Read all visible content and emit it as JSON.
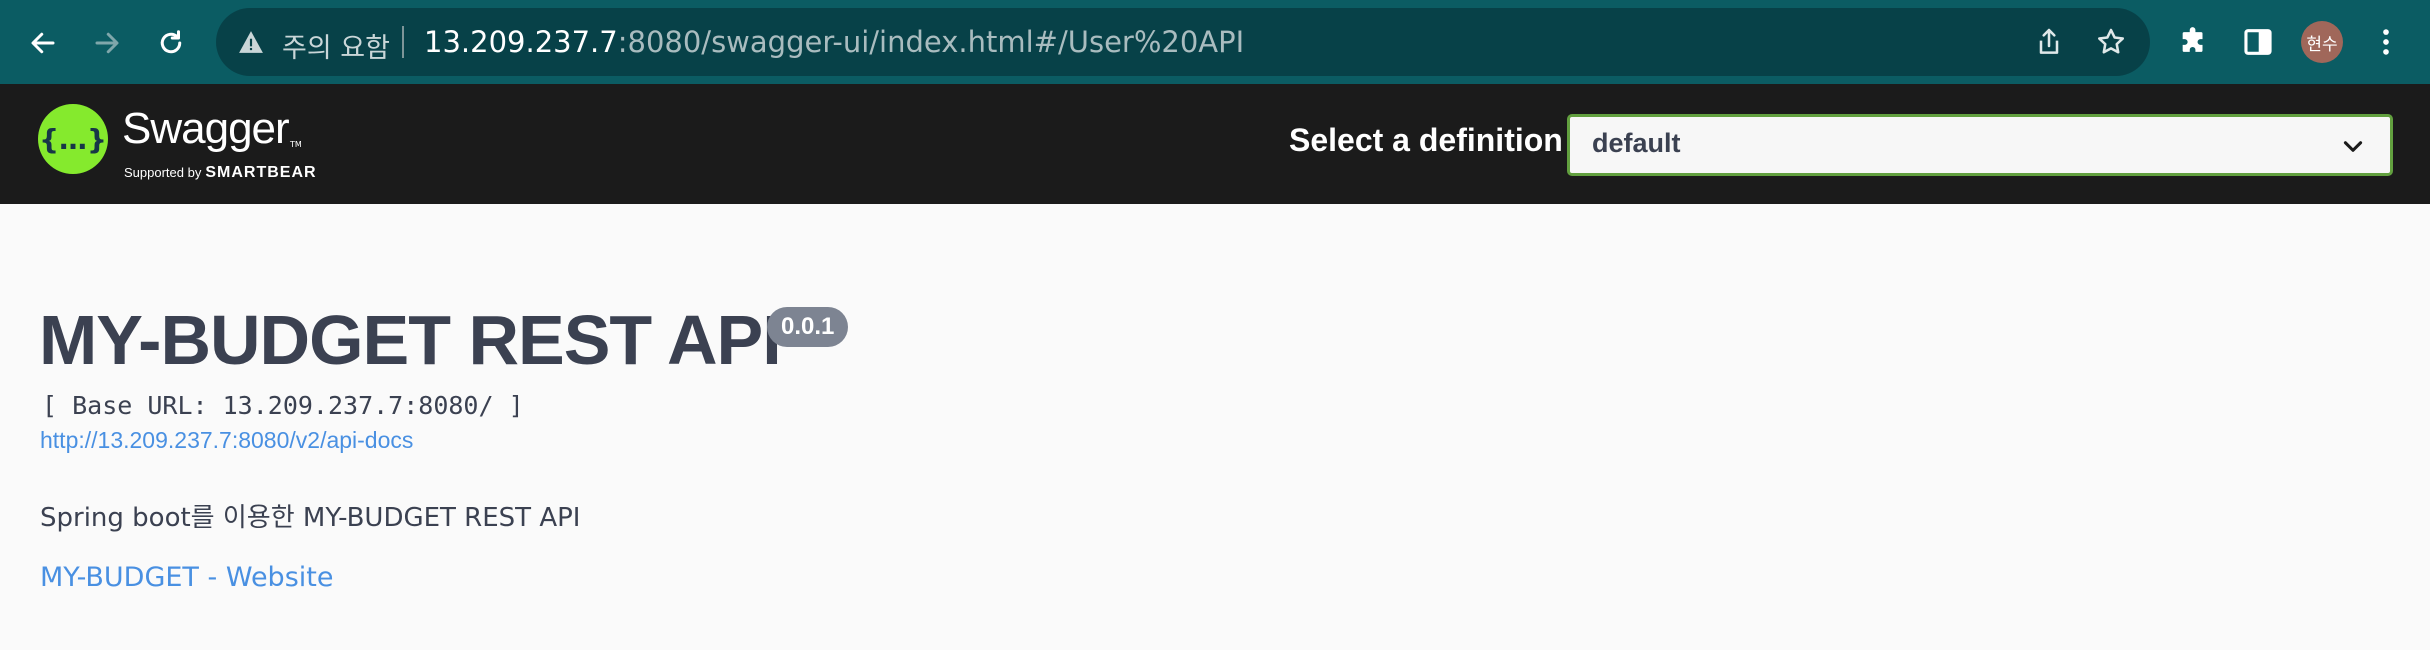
{
  "browser": {
    "security_label": "주의 요함",
    "url_host": "13.209.237.7",
    "url_rest": ":8080/swagger-ui/index.html#/User%20API",
    "profile_initials": "현수",
    "chrome_color": "#0b5c63"
  },
  "topbar": {
    "logo_text": "Swagger",
    "logo_symbol": "{…}",
    "logo_tm": "TM",
    "logo_supported_by": "Supported by",
    "logo_brand": "SMARTBEAR",
    "definition_label": "Select a definition",
    "definition_value": "default",
    "accent_color": "#85ea2d"
  },
  "info": {
    "title": "MY-BUDGET REST API",
    "version": "0.0.1",
    "base_url": "[ Base URL: 13.209.237.7:8080/ ]",
    "api_docs_link": "http://13.209.237.7:8080/v2/api-docs",
    "description": "Spring boot를 이용한 MY-BUDGET REST API",
    "website_link": "MY-BUDGET - Website",
    "link_color": "#4990e2"
  }
}
